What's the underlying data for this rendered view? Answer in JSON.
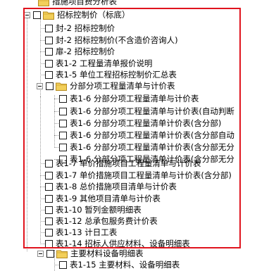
{
  "tree": {
    "top_partial_label": "措施项目费分析表",
    "root": {
      "label": "招标控制价（标底）"
    },
    "items": [
      {
        "label": "封-2 招标控制价"
      },
      {
        "label": "封-2 招标控制价(不含造价咨询人)"
      },
      {
        "label": "扉-2 招标控制价"
      },
      {
        "label": "表1-2 工程量清单报价说明"
      },
      {
        "label": "表1-5 单位工程招标控制价汇总表"
      }
    ],
    "folder": {
      "label": "分部分项工程量清单与计价表",
      "children": [
        {
          "label": "表1-6 分部分项工程量清单与计价表"
        },
        {
          "label": "表1-6 分部分项工程量清单与计价表(自动判断"
        },
        {
          "label": "表1-6 分部分项工程量清单计价表(含分部)"
        },
        {
          "label": "表1-6 分部分项工程量清单计价表(含分部自动"
        },
        {
          "label": "表1-6 分部分项工程量清单计价表(含分部无分"
        },
        {
          "label": "表1-6 分部分项工程量清单计价表(含分部无分"
        }
      ]
    },
    "items2": [
      {
        "label": "表1-7 单价措施项目工程量清单与计价表"
      },
      {
        "label": "表1-7 单价措施项目工程量清单与计价表(含分部)"
      },
      {
        "label": "表1-8 总价措施项目清单与计价表"
      },
      {
        "label": "表1-9 其他项目清单与计价表"
      },
      {
        "label": "表1-10 暂列金额明细表"
      },
      {
        "label": "表1-12 总承包服务费计价表"
      },
      {
        "label": "表1-13 计日工表"
      },
      {
        "label": "表1-14 招标人供应材料、设备明细表"
      }
    ],
    "bottom_folder": {
      "label": "主要材料设备明细表"
    },
    "bottom_item": {
      "label": "表1-15 主要材料、设备明细表"
    }
  },
  "colors": {
    "highlight": "#e0141e",
    "folder": "#f2cf5a"
  }
}
